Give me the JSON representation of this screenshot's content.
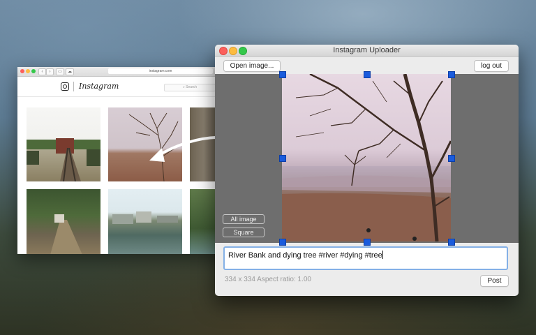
{
  "browser": {
    "url": "instagram.com",
    "logo": "Instagram",
    "search_placeholder": "Search"
  },
  "app": {
    "title": "Instagram Uploader",
    "open_button": "Open image...",
    "logout_button": "log out",
    "all_image_button": "All image",
    "square_button": "Square",
    "caption": "River Bank and dying tree #river #dying #tree",
    "info": "334 x 334 Aspect ratio: 1.00",
    "post_button": "Post"
  },
  "icons": [
    "camera-icon",
    "search-icon",
    "arrow-icon"
  ],
  "colors": {
    "accent": "#1a5bdc",
    "focus_ring": "#84b0e6",
    "close": "#fc605c",
    "minimize": "#fdbc40",
    "zoom": "#34c84a"
  }
}
